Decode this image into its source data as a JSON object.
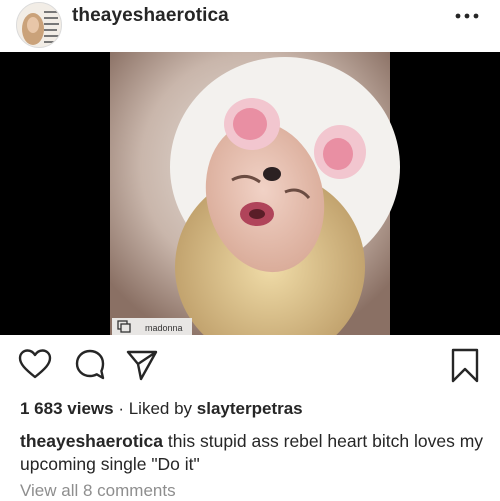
{
  "post": {
    "username": "theayeshaerotica",
    "avatar_text": "If Plex she on... record by... Already at Bought this... a single ... clip?",
    "more_icon": "more-horizontal-icon"
  },
  "media": {
    "watermark_icon": "repost-icon",
    "watermark_label": "madonna"
  },
  "actions": {
    "like_icon": "heart-outline-icon",
    "comment_icon": "comment-bubble-icon",
    "share_icon": "paper-plane-icon",
    "save_icon": "bookmark-outline-icon"
  },
  "stats": {
    "views": "1 683 views",
    "separator": "·",
    "liked_by_prefix": "Liked by",
    "liked_by_user": "slayterpetras"
  },
  "caption": {
    "user": "theayeshaerotica",
    "text": "this stupid ass rebel heart bitch loves my upcoming single \"Do it\""
  },
  "comments": {
    "link": "View all 8 comments"
  }
}
